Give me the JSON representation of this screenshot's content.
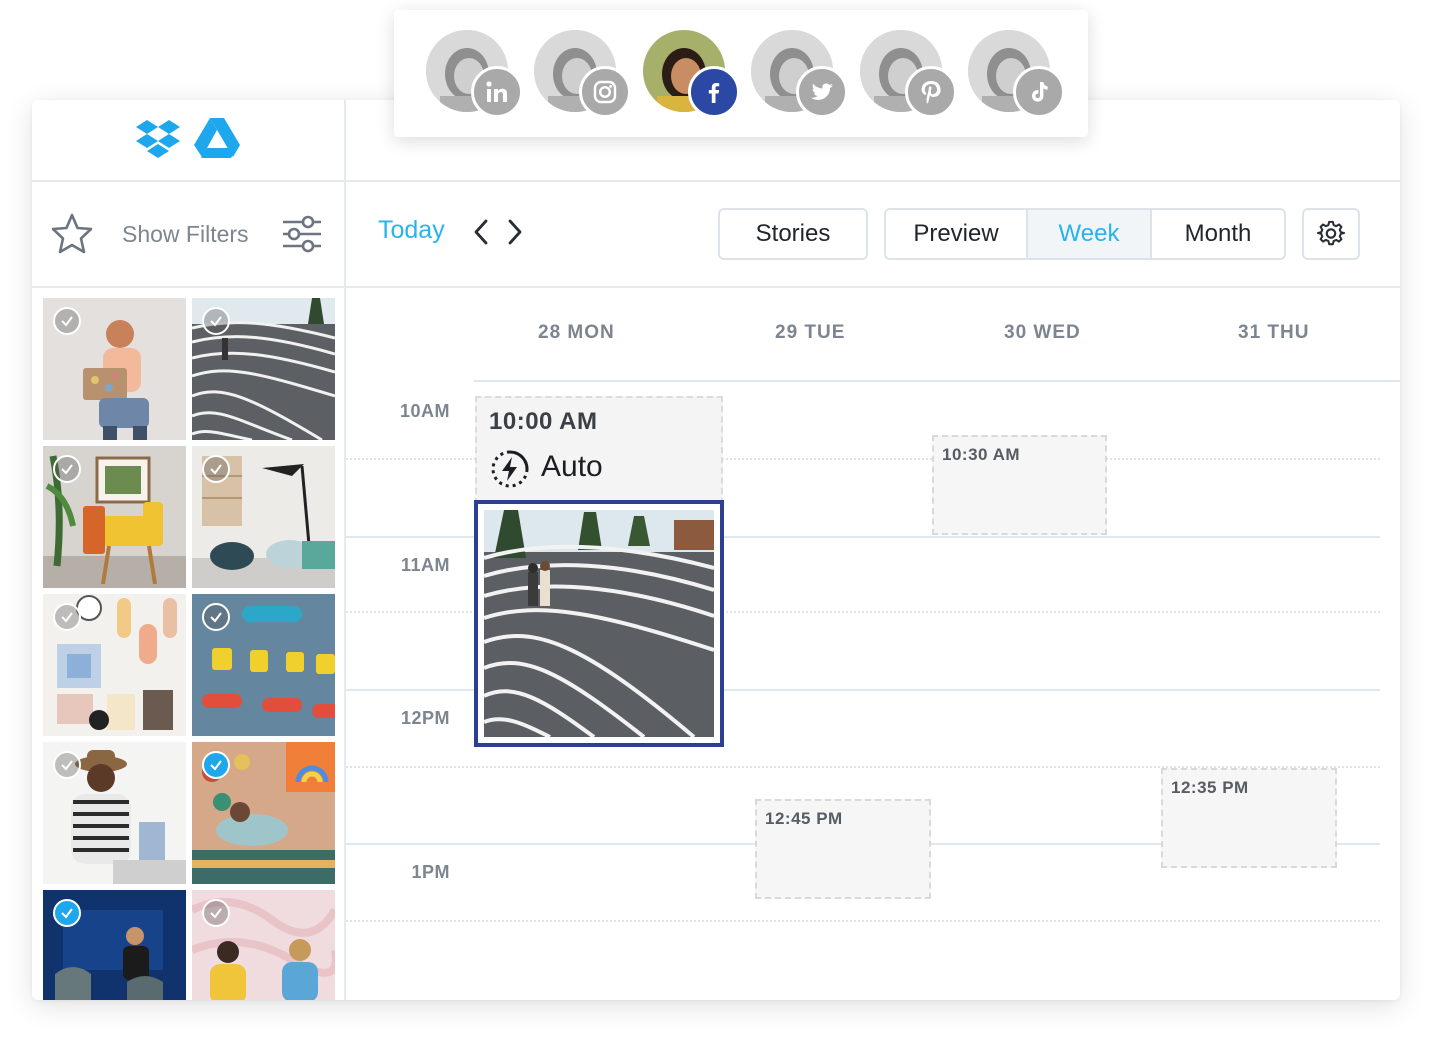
{
  "colors": {
    "accent": "#29b3ea",
    "selected_border": "#2c3f93",
    "facebook_active": "#2a48a4",
    "inactive_network": "#a9a9a9",
    "check_selected": "#1ea7ec"
  },
  "profiles": [
    {
      "network": "linkedin",
      "icon": "linkedin-icon",
      "active": false
    },
    {
      "network": "instagram",
      "icon": "instagram-icon",
      "active": false
    },
    {
      "network": "facebook",
      "icon": "facebook-icon",
      "active": true
    },
    {
      "network": "twitter",
      "icon": "twitter-icon",
      "active": false
    },
    {
      "network": "pinterest",
      "icon": "pinterest-icon",
      "active": false
    },
    {
      "network": "tiktok",
      "icon": "tiktok-icon",
      "active": false
    }
  ],
  "sidebar": {
    "sources": [
      {
        "icon": "dropbox-icon"
      },
      {
        "icon": "google-drive-icon"
      }
    ],
    "filters_label": "Show Filters",
    "media": [
      {
        "selected": false
      },
      {
        "selected": false
      },
      {
        "selected": false
      },
      {
        "selected": false
      },
      {
        "selected": false
      },
      {
        "selected": false
      },
      {
        "selected": false
      },
      {
        "selected": true
      },
      {
        "selected": true
      },
      {
        "selected": false
      }
    ]
  },
  "toolbar": {
    "today_label": "Today",
    "stories_label": "Stories",
    "preview_label": "Preview",
    "week_label": "Week",
    "month_label": "Month",
    "active_view": "Week"
  },
  "calendar": {
    "days": [
      "28 MON",
      "29 TUE",
      "30 WED",
      "31 THU"
    ],
    "hours": [
      "10AM",
      "11AM",
      "12PM",
      "1PM"
    ],
    "auto_post": {
      "time": "10:00 AM",
      "label": "Auto"
    },
    "slots": [
      {
        "day": "30 WED",
        "time": "10:30 AM"
      },
      {
        "day": "29 TUE",
        "time": "12:45 PM"
      },
      {
        "day": "31 THU",
        "time": "12:35 PM"
      }
    ]
  }
}
